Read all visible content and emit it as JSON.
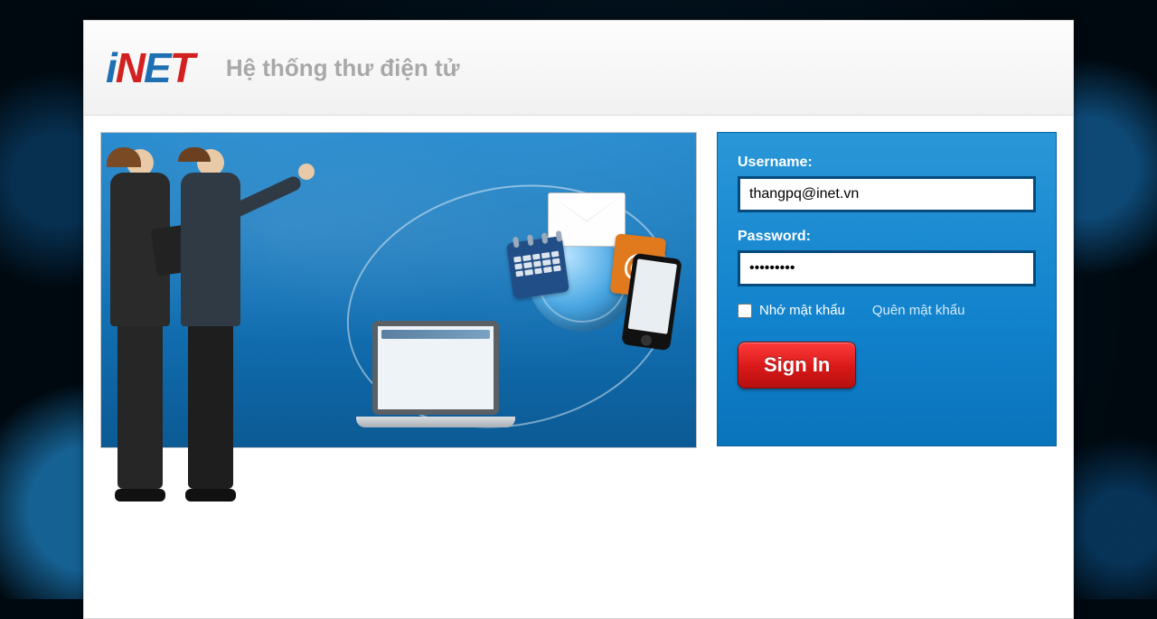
{
  "brand": {
    "name_parts": {
      "i": "i",
      "n": "N",
      "e": "E",
      "t": "T"
    },
    "tagline": "Hệ thống thư điện tử"
  },
  "login": {
    "username_label": "Username:",
    "username_value": "thangpq@inet.vn",
    "password_label": "Password:",
    "password_value": "••••••••",
    "remember_label": "Nhớ mật khẩu",
    "forgot_label": "Quên mật khẩu",
    "submit_label": "Sign In"
  },
  "hero": {
    "at_symbol": "@"
  },
  "colors": {
    "brand_blue": "#1f6fb3",
    "brand_red": "#d32020",
    "login_panel": "#1182cc",
    "button_red": "#d81818"
  }
}
